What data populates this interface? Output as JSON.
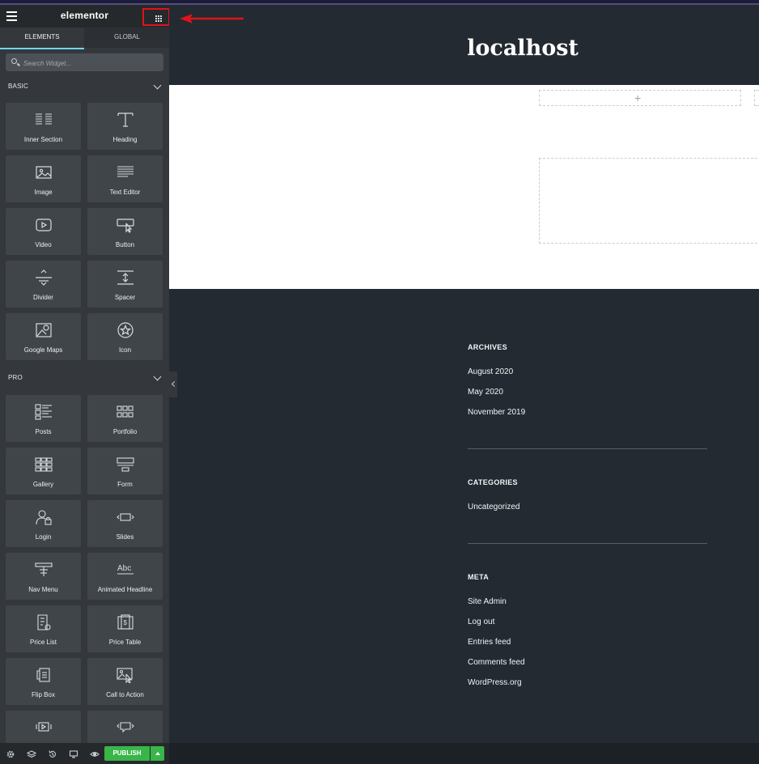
{
  "sidebar": {
    "logo": "elementor",
    "tabs": [
      {
        "label": "ELEMENTS",
        "active": true
      },
      {
        "label": "GLOBAL",
        "active": false
      }
    ],
    "search": {
      "placeholder": "Search Widget...",
      "value": ""
    },
    "categories": [
      {
        "title": "BASIC",
        "widgets": [
          {
            "label": "Inner Section",
            "icon": "inner-section-icon"
          },
          {
            "label": "Heading",
            "icon": "heading-icon"
          },
          {
            "label": "Image",
            "icon": "image-icon"
          },
          {
            "label": "Text Editor",
            "icon": "text-editor-icon"
          },
          {
            "label": "Video",
            "icon": "video-icon"
          },
          {
            "label": "Button",
            "icon": "button-icon"
          },
          {
            "label": "Divider",
            "icon": "divider-icon"
          },
          {
            "label": "Spacer",
            "icon": "spacer-icon"
          },
          {
            "label": "Google Maps",
            "icon": "google-maps-icon"
          },
          {
            "label": "Icon",
            "icon": "star-icon"
          }
        ]
      },
      {
        "title": "PRO",
        "widgets": [
          {
            "label": "Posts",
            "icon": "posts-icon"
          },
          {
            "label": "Portfolio",
            "icon": "portfolio-icon"
          },
          {
            "label": "Gallery",
            "icon": "gallery-icon"
          },
          {
            "label": "Form",
            "icon": "form-icon"
          },
          {
            "label": "Login",
            "icon": "login-icon"
          },
          {
            "label": "Slides",
            "icon": "slides-icon"
          },
          {
            "label": "Nav Menu",
            "icon": "nav-menu-icon"
          },
          {
            "label": "Animated Headline",
            "icon": "animated-headline-icon"
          },
          {
            "label": "Price List",
            "icon": "price-list-icon"
          },
          {
            "label": "Price Table",
            "icon": "price-table-icon"
          },
          {
            "label": "Flip Box",
            "icon": "flip-box-icon"
          },
          {
            "label": "Call to Action",
            "icon": "call-to-action-icon"
          }
        ]
      }
    ],
    "publish_label": "PUBLISH"
  },
  "preview": {
    "site_title": "localhost",
    "widgets": [
      {
        "title": "ARCHIVES",
        "links": [
          "August 2020",
          "May 2020",
          "November 2019"
        ]
      },
      {
        "title": "CATEGORIES",
        "links": [
          "Uncategorized"
        ]
      },
      {
        "title": "META",
        "links": [
          "Site Admin",
          "Log out",
          "Entries feed",
          "Comments feed",
          "WordPress.org"
        ]
      }
    ]
  },
  "colors": {
    "sidebar_bg": "#34383c",
    "accent_tab": "#71d7f7",
    "publish_green": "#39b54a",
    "highlight_red": "#e0121a",
    "canvas_bg": "#232a31"
  }
}
